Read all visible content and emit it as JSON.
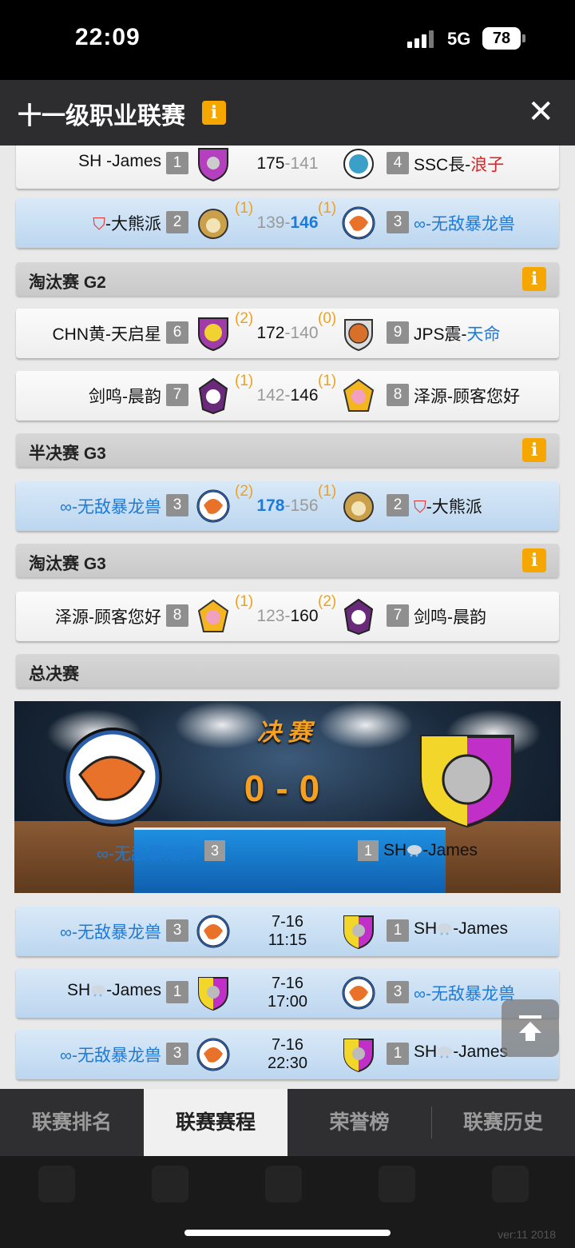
{
  "status": {
    "time": "22:09",
    "network": "5G",
    "battery": "78"
  },
  "header": {
    "title": "十一级职业联赛",
    "info": "i",
    "close": "✕"
  },
  "rows": [
    {
      "left_name": "SH -James",
      "left_seed": "1",
      "score_l": "175",
      "score_r": "141",
      "right_seed": "4",
      "right_name_a": "SSC長-",
      "right_name_b": "浪子"
    },
    {
      "left_name": "-大熊派",
      "left_seed": "2",
      "left_series": "(1)",
      "score_l": "139",
      "score_r": "146",
      "right_series": "(1)",
      "right_seed": "3",
      "right_name": "∞-无敌暴龙兽"
    }
  ],
  "sections": [
    {
      "label": "淘汰赛 G2",
      "info": "i"
    },
    {
      "label": "半决赛 G3",
      "info": "i"
    },
    {
      "label": "淘汰赛 G3",
      "info": "i"
    },
    {
      "label": "总决赛"
    }
  ],
  "g2": [
    {
      "left_name": "CHN黄-天启星",
      "left_seed": "6",
      "left_series": "(2)",
      "score_l": "172",
      "score_r": "140",
      "right_series": "(0)",
      "right_seed": "9",
      "right_name_a": "JPS震-",
      "right_name_b": "天命"
    },
    {
      "left_name": "剑鸣-晨韵",
      "left_seed": "7",
      "left_series": "(1)",
      "score_l": "142",
      "score_r": "146",
      "right_series": "(1)",
      "right_seed": "8",
      "right_name": "泽源-顾客您好"
    }
  ],
  "semi": {
    "left_name": "∞-无敌暴龙兽",
    "left_seed": "3",
    "left_series": "(2)",
    "score_l": "178",
    "score_r": "156",
    "right_series": "(1)",
    "right_seed": "2",
    "right_name": "-大熊派"
  },
  "g3": {
    "left_name": "泽源-顾客您好",
    "left_seed": "8",
    "left_series": "(1)",
    "score_l": "123",
    "score_r": "160",
    "right_series": "(2)",
    "right_seed": "7",
    "right_name": "剑鸣-晨韵"
  },
  "final": {
    "title": "决赛",
    "score_l": "0",
    "dash": "-",
    "score_r": "0",
    "left_name": "∞-无敌暴龙兽",
    "left_seed": "3",
    "right_seed": "1",
    "right_name_a": "SH",
    "right_name_b": "-James"
  },
  "games": [
    {
      "left_name": "∞-无敌暴龙兽",
      "left_seed": "3",
      "date": "7-16",
      "time": "11:15",
      "right_seed": "1",
      "right_name_a": "SH",
      "right_name_b": "-James"
    },
    {
      "left_name_a": "SH",
      "left_name_b": "-James",
      "left_seed": "1",
      "date": "7-16",
      "time": "17:00",
      "right_seed": "3",
      "right_name": "∞-无敌暴龙兽"
    },
    {
      "left_name": "∞-无敌暴龙兽",
      "left_seed": "3",
      "date": "7-16",
      "time": "22:30",
      "right_seed": "1",
      "right_name_a": "SH",
      "right_name_b": "-James"
    }
  ],
  "tabs": [
    "联赛排名",
    "联赛赛程",
    "荣誉榜",
    "联赛历史"
  ],
  "version": "ver:11  2018",
  "colors": {
    "accent_orange": "#f5a700",
    "team_blue": "#1f7ad6",
    "highlight_row": "#cfe2f5"
  }
}
